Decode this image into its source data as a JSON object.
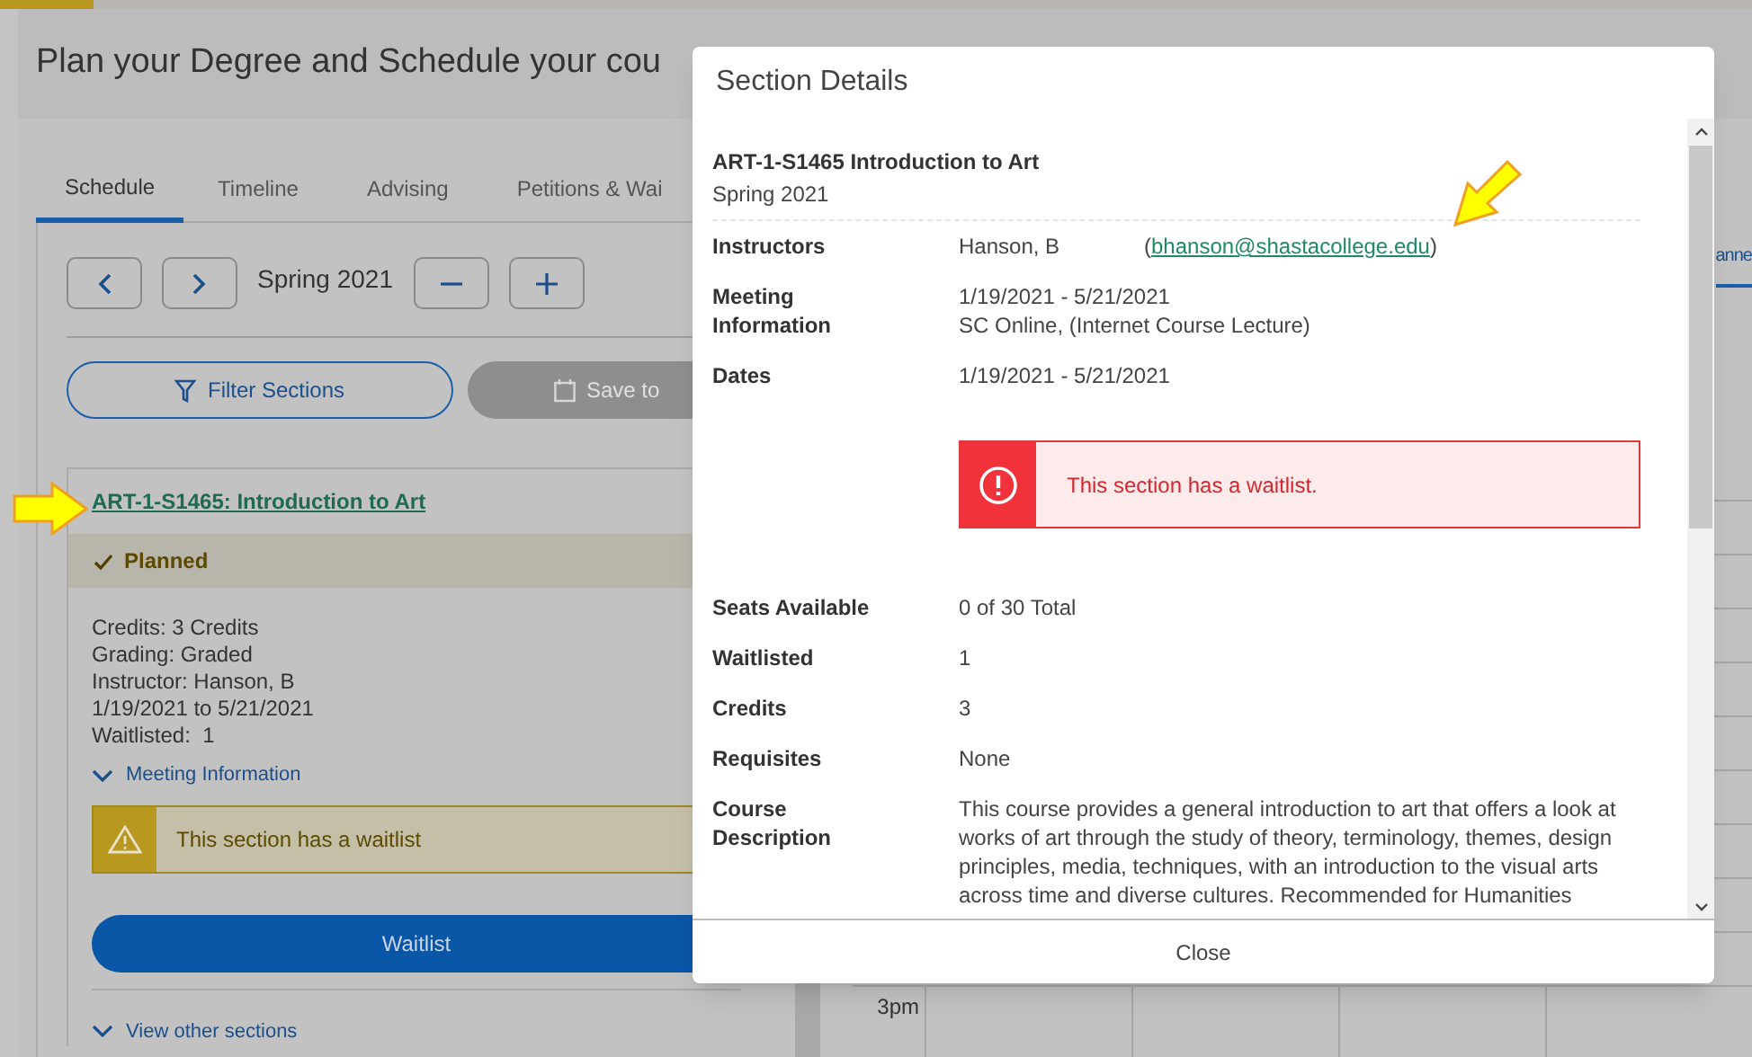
{
  "page_title": "Plan your Degree and Schedule your cou",
  "tabs": [
    {
      "label": "Schedule",
      "selected": true
    },
    {
      "label": "Timeline",
      "selected": false
    },
    {
      "label": "Advising",
      "selected": false
    },
    {
      "label": "Petitions & Wai",
      "selected": false
    }
  ],
  "term": "Spring 2021",
  "filter_button": "Filter Sections",
  "save_button": {
    "label": "Save to",
    "disabled": true
  },
  "section_card": {
    "link": "ART-1-S1465: Introduction to Art",
    "status": "Planned",
    "details": [
      "Credits: 3 Credits",
      "Grading: Graded",
      "Instructor: Hanson, B",
      "1/19/2021 to 5/21/2021",
      "Waitlisted:  1"
    ],
    "meeting_toggle": "Meeting Information",
    "warning": "This section has a waitlist",
    "action": "Waitlist",
    "other_sections": "View other sections"
  },
  "calendar": {
    "tab_fragment": "anne",
    "time_label": "3pm"
  },
  "modal": {
    "title": "Section Details",
    "course": "ART-1-S1465 Introduction to Art",
    "term": "Spring 2021",
    "fields": [
      {
        "kind": "instructor",
        "label": "Instructors",
        "value": "Hanson, B",
        "email_prefix": "(",
        "email": "bhanson@shastacollege.edu",
        "email_suffix": ")"
      },
      {
        "kind": "lines",
        "label": "Meeting Information",
        "lines": [
          "1/19/2021 - 5/21/2021",
          "SC Online, (Internet Course Lecture)"
        ]
      },
      {
        "kind": "text",
        "label": "Dates",
        "value": "1/19/2021 - 5/21/2021"
      },
      {
        "kind": "alert",
        "message": "This section has a waitlist."
      },
      {
        "kind": "text",
        "label": "Seats Available",
        "value": "0 of 30 Total"
      },
      {
        "kind": "text",
        "label": "Waitlisted",
        "value": "1"
      },
      {
        "kind": "text",
        "label": "Credits",
        "value": "3"
      },
      {
        "kind": "text",
        "label": "Requisites",
        "value": "None"
      },
      {
        "kind": "text",
        "label": "Course Description",
        "value": "This course provides a general introduction to art that offers a look at works of art through the study of theory, terminology, themes, design principles, media, techniques, with an introduction to the visual arts across time and diverse cultures. Recommended for Humanities"
      }
    ],
    "close": "Close"
  }
}
